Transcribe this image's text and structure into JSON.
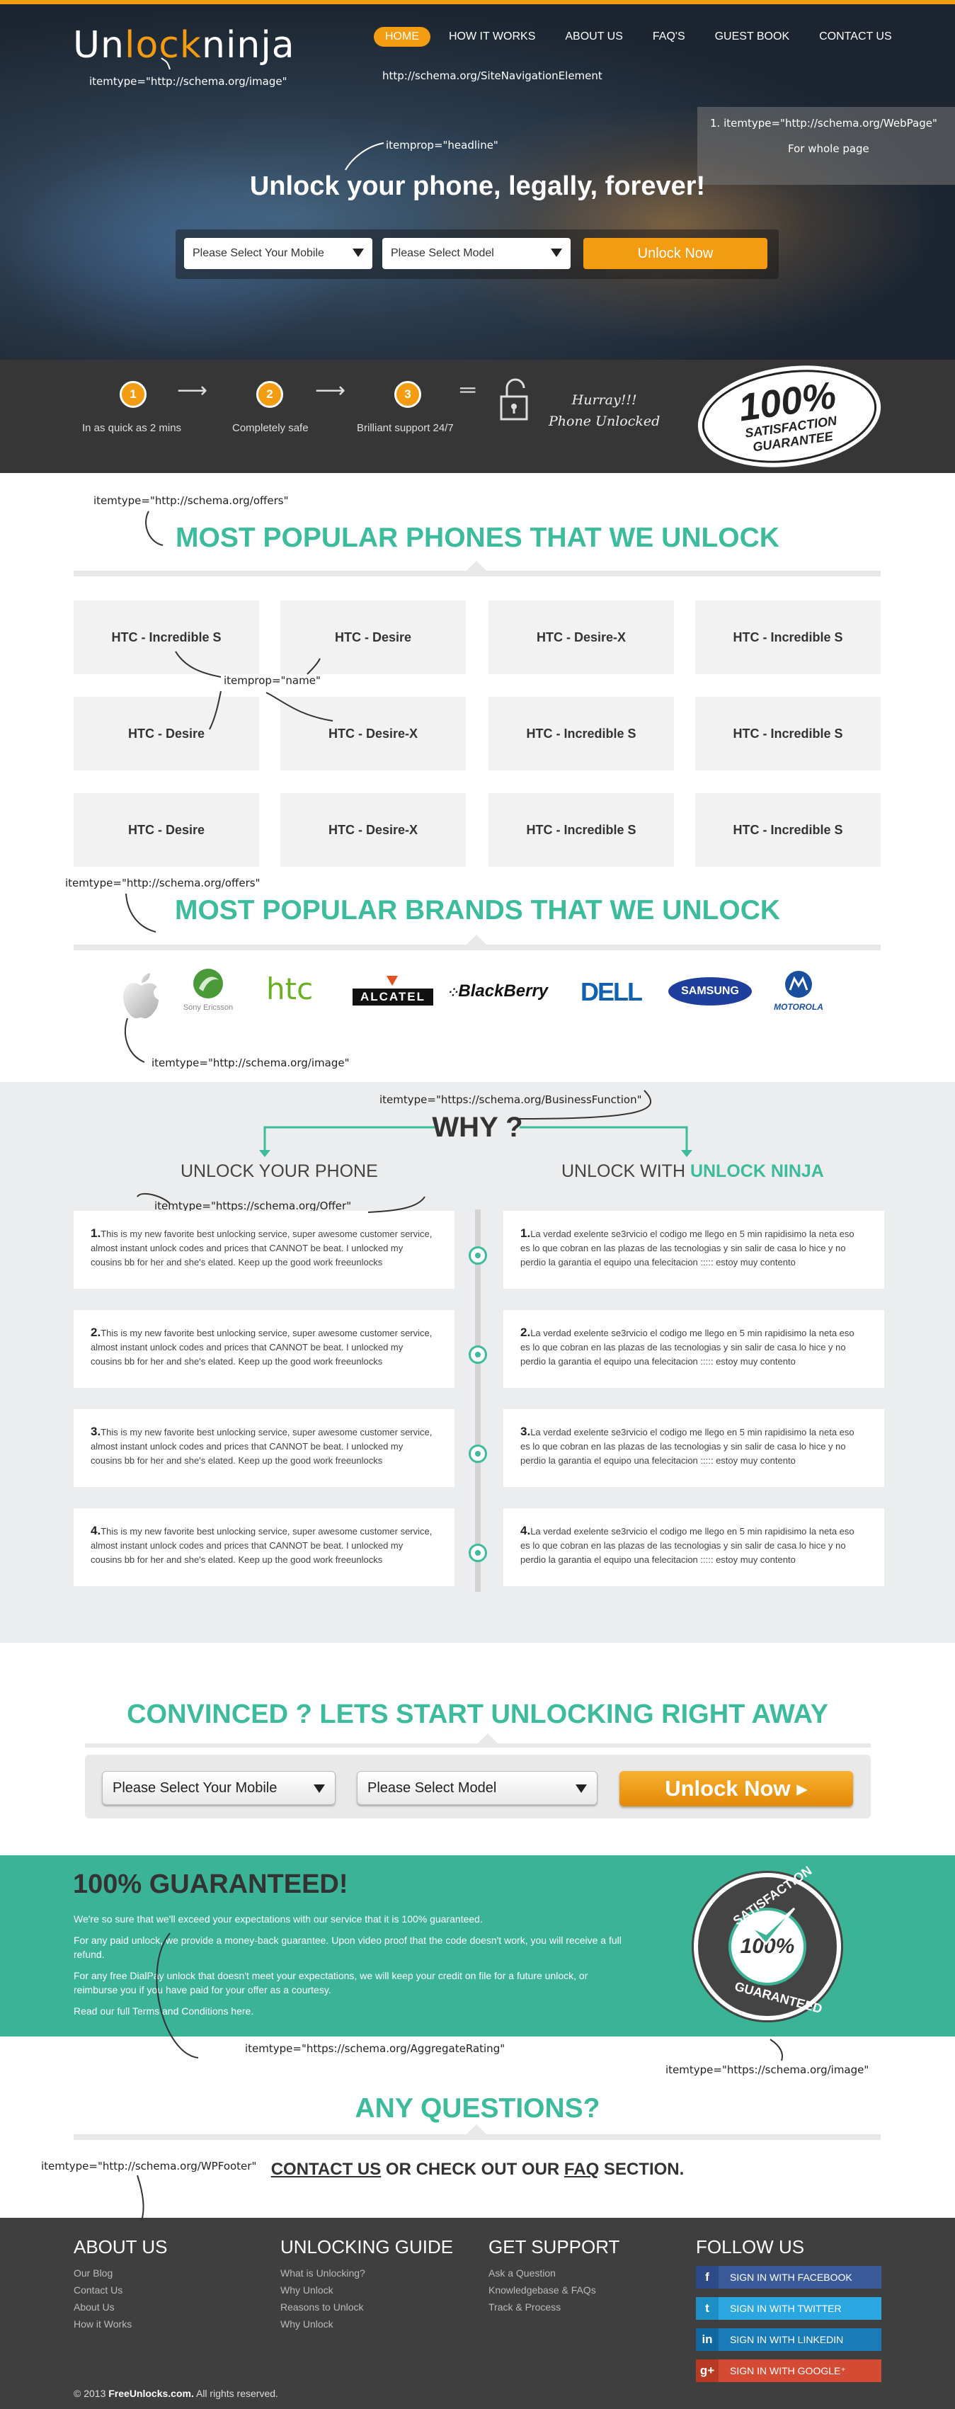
{
  "header": {
    "logo_pre": "Un",
    "logo_o": "lo",
    "logo_mid": "ck",
    "logo_post": "ninja",
    "nav": [
      "HOME",
      "HOW IT WORKS",
      "ABOUT US",
      "FAQ'S",
      "GUEST BOOK",
      "CONTACT US"
    ],
    "headline": "Unlock your phone, legally, forever!",
    "select_mobile": "Please Select Your Mobile",
    "select_model": "Please Select Model",
    "unlock_button": "Unlock Now"
  },
  "annotations": {
    "logo_image": "itemtype=\"http://schema.org/image\"",
    "nav_element": "http://schema.org/SiteNavigationElement",
    "webpage": "1. itemtype=\"http://schema.org/WebPage\"",
    "webpage_note": "For whole page",
    "headline": "itemprop=\"headline\"",
    "offers_1": "itemtype=\"http://schema.org/offers\"",
    "name": "itemprop=\"name\"",
    "offers_2": "itemtype=\"http://schema.org/offers\"",
    "brand_image": "itemtype=\"http://schema.org/image\"",
    "business_function": "itemtype=\"https://schema.org/BusinessFunction\"",
    "offer": "itemtype=\"https://schema.org/Offer\"",
    "aggregate_rating": "itemtype=\"https://schema.org/AggregateRating\"",
    "seal_image": "itemtype=\"https://schema.org/image\"",
    "footer": "itemtype=\"http://schema.org/WPFooter\""
  },
  "steps": {
    "items": [
      {
        "num": "1",
        "label": "In as quick as 2 mins"
      },
      {
        "num": "2",
        "label": "Completely safe"
      },
      {
        "num": "3",
        "label": "Brilliant support 24/7"
      }
    ],
    "hurray_1": "Hurray!!!",
    "hurray_2": "Phone Unlocked",
    "badge_big": "100%",
    "badge_l1": "SATISFACTION",
    "badge_l2": "GUARANTEE"
  },
  "phones": {
    "title": "MOST POPULAR PHONES THAT WE UNLOCK",
    "cards": [
      "HTC - Incredible S",
      "HTC - Desire",
      "HTC - Desire-X",
      "HTC - Incredible S",
      "HTC - Desire",
      "HTC - Desire-X",
      "HTC - Incredible S",
      "HTC - Incredible S",
      "HTC - Desire",
      "HTC - Desire-X",
      "HTC - Incredible S",
      "HTC - Incredible S"
    ]
  },
  "brands": {
    "title": "MOST POPULAR BRANDS THAT WE UNLOCK",
    "sony_ericsson": "Sony Ericsson",
    "htc": "htc",
    "alcatel": "ALCATEL",
    "blackberry": "BlackBerry",
    "dell": "DELL",
    "samsung": "SAMSUNG",
    "motorola": "MOTOROLA"
  },
  "why": {
    "title": "WHY ?",
    "left_head": "UNLOCK YOUR PHONE",
    "right_head_pre": "UNLOCK WITH ",
    "right_head_brand": "UNLOCK NINJA",
    "left_items": [
      {
        "num": "1.",
        "l1": "This is my new favorite best unlocking service, super awesome customer service,",
        "l2": "almost instant unlock codes and prices that CANNOT be beat. I unlocked my",
        "l3": "cousins bb for her and she's elated. Keep up the good work freeunlocks"
      },
      {
        "num": "2.",
        "l1": "This is my new favorite best unlocking service, super awesome customer service,",
        "l2": "almost instant unlock codes and prices that CANNOT be beat. I unlocked my",
        "l3": "cousins bb for her and she's elated. Keep up the good work freeunlocks"
      },
      {
        "num": "3.",
        "l1": "This is my new favorite best unlocking service, super awesome customer service,",
        "l2": "almost instant unlock codes and prices that CANNOT be beat. I unlocked my",
        "l3": "cousins bb for her and she's elated. Keep up the good work freeunlocks"
      },
      {
        "num": "4.",
        "l1": "This is my new favorite best unlocking service, super awesome customer service,",
        "l2": "almost instant unlock codes and prices that CANNOT be beat. I unlocked my",
        "l3": "cousins bb for her and she's elated. Keep up the good work freeunlocks"
      }
    ],
    "right_items": [
      {
        "num": "1.",
        "l1": "La verdad exelente se3rvicio el codigo me llego en 5 min rapidisimo la neta eso",
        "l2": "es lo que cobran en las plazas de las tecnologias y sin salir de casa lo hice y no",
        "l3": "perdio la garantia el equipo una felecitacion ::::: estoy muy contento"
      },
      {
        "num": "2.",
        "l1": "La verdad exelente se3rvicio el codigo me llego en 5 min rapidisimo la neta eso",
        "l2": "es lo que cobran en las plazas de las tecnologias y sin salir de casa lo hice y no",
        "l3": "perdio la garantia el equipo una felecitacion ::::: estoy muy contento"
      },
      {
        "num": "3.",
        "l1": "La verdad exelente se3rvicio el codigo me llego en 5 min rapidisimo la neta eso",
        "l2": "es lo que cobran en las plazas de las tecnologias y sin salir de casa lo hice y no",
        "l3": "perdio la garantia el equipo una felecitacion ::::: estoy muy contento"
      },
      {
        "num": "4.",
        "l1": "La verdad exelente se3rvicio el codigo me llego en 5 min rapidisimo la neta eso",
        "l2": "es lo que cobran en las plazas de las tecnologias y sin salir de casa lo hice y no",
        "l3": "perdio la garantia el equipo una felecitacion ::::: estoy muy contento"
      }
    ]
  },
  "convinced": {
    "title": "CONVINCED ? LETS START UNLOCKING RIGHT AWAY",
    "select_mobile": "Please Select Your Mobile",
    "select_model": "Please Select Model",
    "button": "Unlock Now ▸"
  },
  "guaranteed": {
    "title": "100% GUARANTEED!",
    "p1": "We're so sure that we'll exceed your expectations with our service that it is 100% guaranteed.",
    "p2a": "For any paid unlock, we provide a money-back guarantee. Upon video proof that the code doesn't work, you will receive a full",
    "p2b": "refund.",
    "p3a": "For any free DialPay unlock that doesn't meet your expectations, we will keep your credit on file for a future unlock, or",
    "p3b": "reimburse you if you have paid for your offer as a courtesy.",
    "p4": "Read our full Terms and Conditions here.",
    "seal_center": "100%",
    "seal_top": "SATISFACTION",
    "seal_bottom": "GUARANTEED"
  },
  "questions": {
    "title": "ANY QUESTIONS?",
    "contact": "CONTACT US",
    "mid": " OR CHECK OUT OUR ",
    "faq": "FAQ",
    "end": " SECTION."
  },
  "footer": {
    "about_title": "ABOUT US",
    "about_links": [
      "Our Blog",
      "Contact Us",
      "About Us",
      "How it Works"
    ],
    "guide_title": "UNLOCKING GUIDE",
    "guide_links": [
      "What is Unlocking?",
      "Why Unlock",
      "Reasons to Unlock",
      "Why Unlock"
    ],
    "support_title": "GET SUPPORT",
    "support_links": [
      "Ask a Question",
      "Knowledgebase & FAQs",
      "Track & Process"
    ],
    "follow_title": "FOLLOW US",
    "social": [
      {
        "icon": "f",
        "label": "SIGN IN WITH FACEBOOK",
        "color": "#3b5a9a"
      },
      {
        "icon": "t",
        "label": "SIGN IN WITH TWITTER",
        "color": "#2aa7e0"
      },
      {
        "icon": "in",
        "label": "SIGN IN WITH LINKEDIN",
        "color": "#1a7bb9"
      },
      {
        "icon": "g+",
        "label": "SIGN IN WITH GOOGLE⁺",
        "color": "#d44a33"
      }
    ],
    "copyright_pre": "© 2013 ",
    "copyright_site": "FreeUnlocks.com.",
    "copyright_post": " All rights reserved."
  }
}
